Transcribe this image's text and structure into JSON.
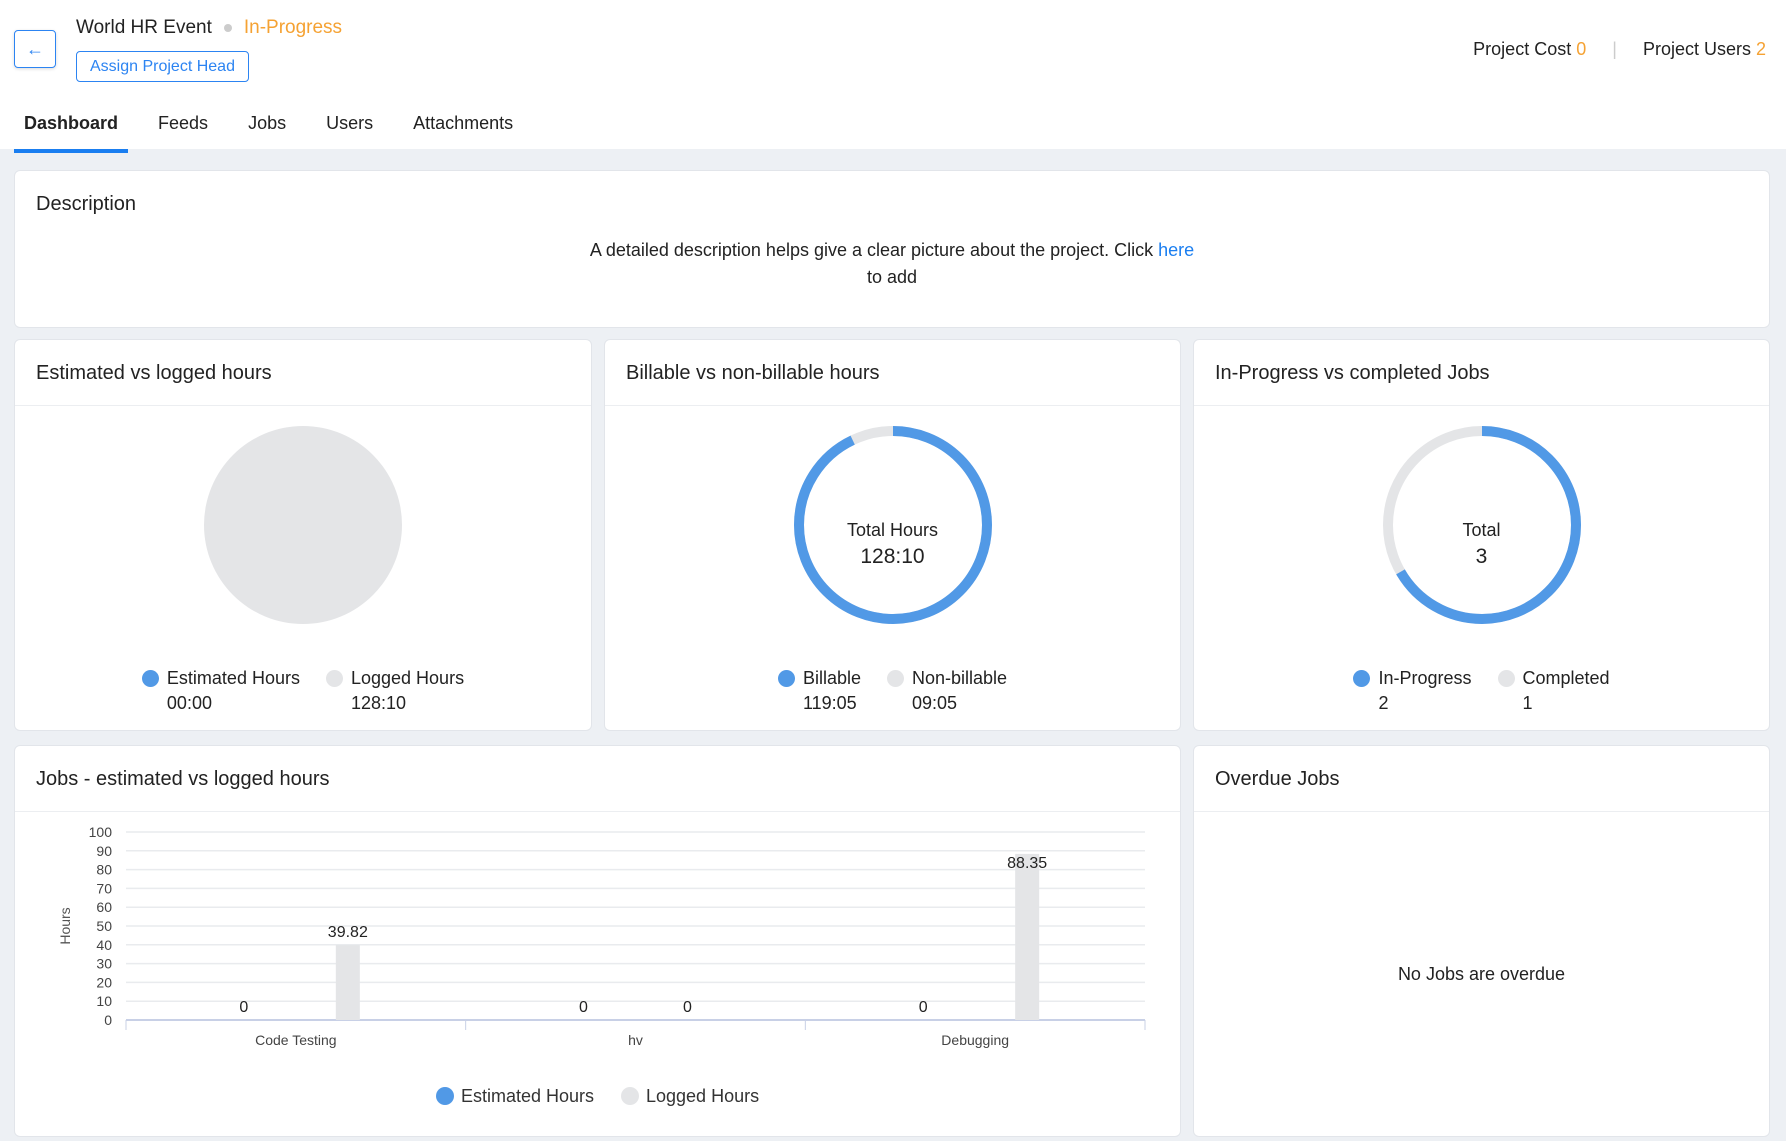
{
  "header": {
    "back_icon": "arrow-left-icon",
    "project_name": "World HR Event",
    "status": "In-Progress",
    "assign_label": "Assign Project Head",
    "cost_label": "Project Cost",
    "cost_value": "0",
    "users_label": "Project Users",
    "users_value": "2"
  },
  "tabs": [
    "Dashboard",
    "Feeds",
    "Jobs",
    "Users",
    "Attachments"
  ],
  "description": {
    "title": "Description",
    "text": "A detailed description helps give a clear picture about the project. Click ",
    "link": "here",
    "text2": " to add"
  },
  "est_logged": {
    "title": "Estimated vs logged hours",
    "legend": [
      {
        "label": "Estimated Hours",
        "value": "00:00"
      },
      {
        "label": "Logged Hours",
        "value": "128:10"
      }
    ]
  },
  "billable": {
    "title": "Billable vs non-billable hours",
    "center_label": "Total Hours",
    "center_value": "128:10",
    "fraction": 0.929,
    "legend": [
      {
        "label": "Billable",
        "value": "119:05"
      },
      {
        "label": "Non-billable",
        "value": "09:05"
      }
    ]
  },
  "jobs_status": {
    "title": "In-Progress vs completed Jobs",
    "center_label": "Total",
    "center_value": "3",
    "fraction": 0.6667,
    "legend": [
      {
        "label": "In-Progress",
        "value": "2"
      },
      {
        "label": "Completed",
        "value": "1"
      }
    ]
  },
  "overdue": {
    "title": "Overdue Jobs",
    "empty": "No Jobs are overdue"
  },
  "colors": {
    "blue": "#5199e6",
    "gray": "#e4e5e7"
  },
  "chart_data": {
    "type": "bar",
    "title": "Jobs - estimated vs logged hours",
    "categories": [
      "Code Testing",
      "hv",
      "Debugging"
    ],
    "series": [
      {
        "name": "Estimated Hours",
        "values": [
          0,
          0,
          0
        ]
      },
      {
        "name": "Logged Hours",
        "values": [
          39.82,
          0,
          88.35
        ]
      }
    ],
    "ylabel": "Hours",
    "ylim": [
      0,
      100
    ],
    "yticks": [
      0,
      10,
      20,
      30,
      40,
      50,
      60,
      70,
      80,
      90,
      100
    ],
    "grid": true,
    "legend": "bottom"
  }
}
